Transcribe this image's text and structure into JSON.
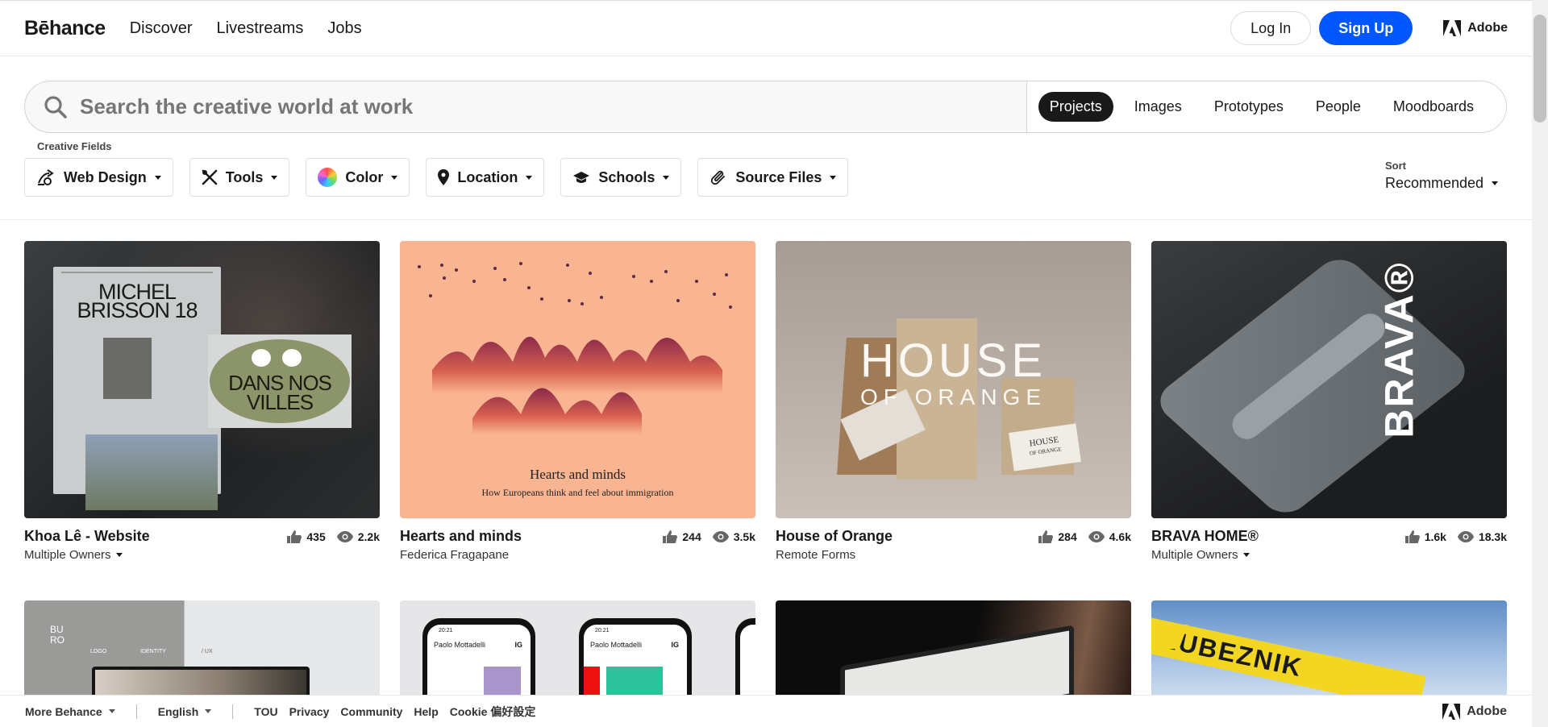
{
  "nav": {
    "logo": "Bēhance",
    "links": [
      "Discover",
      "Livestreams",
      "Jobs"
    ],
    "login": "Log In",
    "signup": "Sign Up",
    "adobe": "Adobe"
  },
  "search": {
    "placeholder": "Search the creative world at work",
    "tabs": [
      "Projects",
      "Images",
      "Prototypes",
      "People",
      "Moodboards"
    ],
    "active_tab": "Projects"
  },
  "filters": {
    "creative_fields_caption": "Creative Fields",
    "items": [
      "Web Design",
      "Tools",
      "Color",
      "Location",
      "Schools",
      "Source Files"
    ]
  },
  "sort": {
    "caption": "Sort",
    "value": "Recommended"
  },
  "cards": [
    {
      "title": "Khoa Lê - Website",
      "owner": "Multiple Owners",
      "owner_dropdown": true,
      "likes": "435",
      "views": "2.2k",
      "art": {
        "line1": "MICHEL",
        "line2": "BRISSON 18",
        "oval1": "DANS NOS",
        "oval2": "VILLES"
      }
    },
    {
      "title": "Hearts and minds",
      "owner": "Federica Fragapane",
      "owner_dropdown": false,
      "likes": "244",
      "views": "3.5k",
      "art": {
        "heading": "Hearts and minds",
        "sub": "How Europeans think and feel about immigration"
      }
    },
    {
      "title": "House of Orange",
      "owner": "Remote Forms",
      "owner_dropdown": false,
      "likes": "284",
      "views": "4.6k",
      "art": {
        "line1": "HOUSE",
        "line2": "OF ORANGE",
        "card1": "HOUSE",
        "card2": "OF ORANGE"
      }
    },
    {
      "title": "BRAVA HOME®",
      "owner": "Multiple Owners",
      "owner_dropdown": true,
      "likes": "1.6k",
      "views": "18.3k",
      "art": {
        "brand": "BRAVA®"
      }
    }
  ],
  "row2_art": {
    "buro": "BU\nRO",
    "logo_label": "LOGO",
    "identity_label": "IDENTITY",
    "ux_label": "/ UX",
    "phone_name": "Paolo Mottadelli",
    "phone_ig": "IG",
    "phone_time": "20:21",
    "lubeznik": "LUBEZNIK"
  },
  "footer": {
    "more": "More Behance",
    "lang": "English",
    "links": [
      "TOU",
      "Privacy",
      "Community",
      "Help",
      "Cookie 偏好設定"
    ],
    "adobe": "Adobe"
  },
  "colors": {
    "brand_blue": "#0057ff",
    "text": "#191919"
  }
}
